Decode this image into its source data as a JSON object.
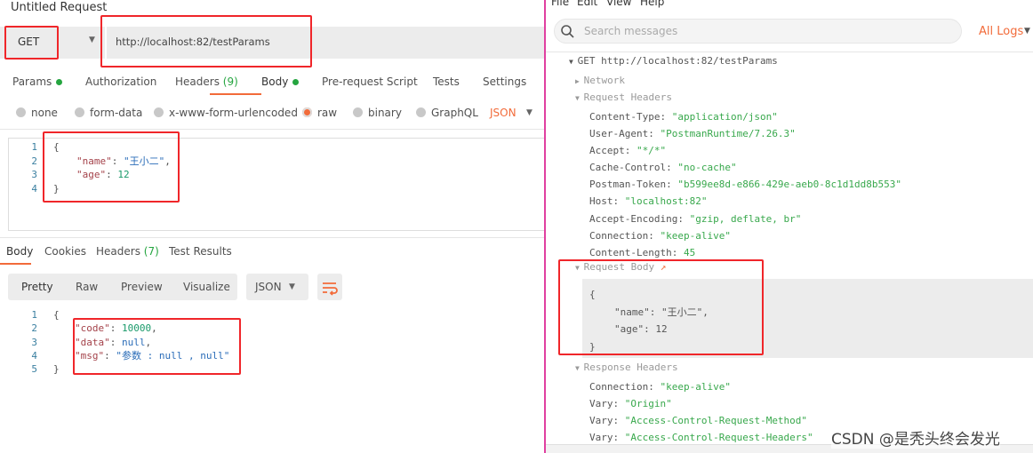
{
  "request": {
    "title": "Untitled Request",
    "method": "GET",
    "url": "http://localhost:82/testParams",
    "tabs": [
      {
        "label": "Params",
        "dot": true
      },
      {
        "label": "Authorization"
      },
      {
        "label": "Headers",
        "count": "(9)"
      },
      {
        "label": "Body",
        "dot": true,
        "active": true
      },
      {
        "label": "Pre-request Script"
      },
      {
        "label": "Tests"
      },
      {
        "label": "Settings"
      }
    ],
    "body_types": [
      "none",
      "form-data",
      "x-www-form-urlencoded",
      "raw",
      "binary",
      "GraphQL"
    ],
    "body_selected": "raw",
    "format": "JSON",
    "code": {
      "lines": [
        "1",
        "2",
        "3",
        "4"
      ],
      "open": "{",
      "name_key": "\"name\"",
      "name_val": "\"王小二\"",
      "age_key": "\"age\"",
      "age_val": "12",
      "close": "}"
    }
  },
  "response": {
    "tabs": [
      {
        "label": "Body",
        "active": true
      },
      {
        "label": "Cookies"
      },
      {
        "label": "Headers",
        "count": "(7)"
      },
      {
        "label": "Test Results"
      }
    ],
    "views": [
      "Pretty",
      "Raw",
      "Preview",
      "Visualize"
    ],
    "format": "JSON",
    "code": {
      "lines": [
        "1",
        "2",
        "3",
        "4",
        "5"
      ],
      "open": "{",
      "code_key": "\"code\"",
      "code_val": "10000",
      "data_key": "\"data\"",
      "data_val": "null",
      "msg_key": "\"msg\"",
      "msg_val": "\"参数 : null , null\"",
      "close": "}"
    }
  },
  "console": {
    "menu": [
      "File",
      "Edit",
      "View",
      "Help"
    ],
    "search_placeholder": "Search messages",
    "filter": "All Logs",
    "entry": "GET http://localhost:82/testParams",
    "network": "Network",
    "req_headers_label": "Request Headers",
    "req_headers": [
      {
        "k": "Content-Type:",
        "v": "\"application/json\""
      },
      {
        "k": "User-Agent:",
        "v": "\"PostmanRuntime/7.26.3\""
      },
      {
        "k": "Accept:",
        "v": "\"*/*\""
      },
      {
        "k": "Cache-Control:",
        "v": "\"no-cache\""
      },
      {
        "k": "Postman-Token:",
        "v": "\"b599ee8d-e866-429e-aeb0-8c1d1dd8b553\""
      },
      {
        "k": "Host:",
        "v": "\"localhost:82\""
      },
      {
        "k": "Accept-Encoding:",
        "v": "\"gzip, deflate, br\""
      },
      {
        "k": "Connection:",
        "v": "\"keep-alive\""
      },
      {
        "k": "Content-Length:",
        "v": "45"
      }
    ],
    "req_body_label": "Request Body",
    "req_body": [
      "{",
      "\"name\": \"王小二\",",
      "\"age\": 12",
      "}"
    ],
    "resp_headers_label": "Response Headers",
    "resp_headers": [
      {
        "k": "Connection:",
        "v": "\"keep-alive\""
      },
      {
        "k": "Vary:",
        "v": "\"Origin\""
      },
      {
        "k": "Vary:",
        "v": "\"Access-Control-Request-Method\""
      },
      {
        "k": "Vary:",
        "v": "\"Access-Control-Request-Headers\""
      }
    ]
  },
  "watermark": "CSDN @是秃头终会发光",
  "colors": {
    "accent": "#f26b3a",
    "green": "#25a540",
    "highlight": "#f0262a"
  }
}
